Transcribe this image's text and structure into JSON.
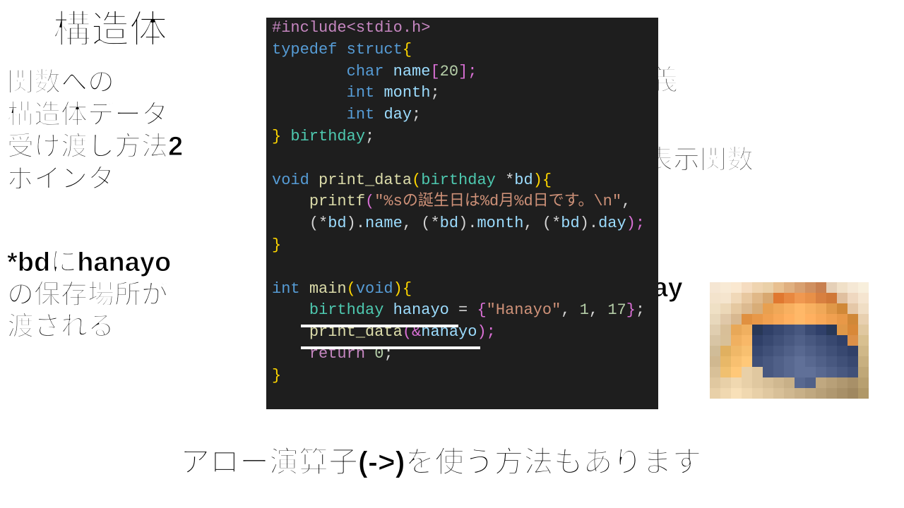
{
  "title": "構造体",
  "subtitle": "関数への\n構造体データ\n受け渡し方法2\nポインタ",
  "note1": "*bdにhanayo\nの保存場所が\n渡される",
  "label_struct_def": "構造体定義",
  "label_print_func": "構造体内容表示関数",
  "label_arrow": "or\nbd->day",
  "bottom_text": "アロー演算子(->)を使う方法もあります",
  "code": {
    "l1a": "#include",
    "l1b": "<stdio.h>",
    "l2a": "typedef",
    "l2b": "struct",
    "l2c": "{",
    "l3a": "char",
    "l3b": "name",
    "l3c": "[",
    "l3d": "20",
    "l3e": "];",
    "l4a": "int",
    "l4b": "month",
    "l4c": ";",
    "l5a": "int",
    "l5b": "day",
    "l5c": ";",
    "l6a": "}",
    "l6b": "birthday",
    "l6c": ";",
    "l8a": "void",
    "l8b": "print_data",
    "l8c": "(",
    "l8d": "birthday",
    "l8e": "*",
    "l8f": "bd",
    "l8g": ")",
    "l8h": "{",
    "l9a": "printf",
    "l9b": "(",
    "l9c": "\"%sの誕生日は%d月%d日です。\\n\"",
    "l9d": ",",
    "l10a": "(*",
    "l10b": "bd",
    "l10c": ").",
    "l10d": "name",
    "l10e": ", (*",
    "l10f": "bd",
    "l10g": ").",
    "l10h": "month",
    "l10i": ", (*",
    "l10j": "bd",
    "l10k": ").",
    "l10l": "day",
    "l10m": ");",
    "l11a": "}",
    "l13a": "int",
    "l13b": "main",
    "l13c": "(",
    "l13d": "void",
    "l13e": ")",
    "l13f": "{",
    "l14a": "birthday",
    "l14b": "hanayo",
    "l14c": " = ",
    "l14d": "{",
    "l14e": "\"Hanayo\"",
    "l14f": ", ",
    "l14g": "1",
    "l14h": ", ",
    "l14i": "17",
    "l14j": "}",
    "l14k": ";",
    "l15a": "print_data",
    "l15b": "(&",
    "l15c": "hanayo",
    "l15d": ");",
    "l16a": "return",
    "l16b": "0",
    "l16c": ";",
    "l17a": "}"
  },
  "mosaic_colors": [
    "#f5e6d3",
    "#f8ead5",
    "#fae8d0",
    "#f5dcc0",
    "#efd4b0",
    "#ead0a8",
    "#e8c090",
    "#e0b080",
    "#d8a070",
    "#d09060",
    "#c88050",
    "#e5d0b8",
    "#f0e0c8",
    "#f5e8d5",
    "#f8efdc",
    "#f3e3cc",
    "#f5e5ce",
    "#f0d8b8",
    "#e8c8a0",
    "#e0b888",
    "#d8a870",
    "#e07830",
    "#e88840",
    "#f09850",
    "#e89048",
    "#d88040",
    "#d07838",
    "#e0c0a0",
    "#efd8c0",
    "#f5e5d0",
    "#efe0c5",
    "#ecd8b8",
    "#e5c8a0",
    "#dcba90",
    "#d8ad78",
    "#e8a050",
    "#f0a858",
    "#f8b060",
    "#ffb868",
    "#f8b060",
    "#f0a858",
    "#e09848",
    "#d08838",
    "#e5c8a8",
    "#f0dec5",
    "#e8d8bc",
    "#e0c8a8",
    "#d8b890",
    "#e09040",
    "#e89848",
    "#f0a050",
    "#f8a858",
    "#ffb060",
    "#ffb868",
    "#ffb060",
    "#f8a858",
    "#f0a050",
    "#e89848",
    "#d08838",
    "#e8d0b0",
    "#e0ceb0",
    "#d8bf98",
    "#e8a858",
    "#f0b060",
    "#283858",
    "#304068",
    "#384870",
    "#405078",
    "#485880",
    "#3a4a72",
    "#30406a",
    "#283858",
    "#e09848",
    "#d88838",
    "#e0c8a0",
    "#d8c5a5",
    "#d8c098",
    "#f0b060",
    "#f8b868",
    "#304068",
    "#384870",
    "#405078",
    "#485880",
    "#506088",
    "#485880",
    "#405078",
    "#384870",
    "#304068",
    "#dc9048",
    "#d8c090",
    "#d0bc98",
    "#e0b060",
    "#f0b868",
    "#f8c070",
    "#384870",
    "#405078",
    "#485880",
    "#506088",
    "#586890",
    "#506088",
    "#485880",
    "#405078",
    "#384870",
    "#304068",
    "#d0b888",
    "#d0b890",
    "#e8b868",
    "#f8c070",
    "#ffc878",
    "#405078",
    "#485880",
    "#506088",
    "#586890",
    "#607098",
    "#586890",
    "#506088",
    "#485880",
    "#405078",
    "#384870",
    "#c8b080",
    "#d8c098",
    "#f0c070",
    "#ffc878",
    "#e8d0a8",
    "#e0c8a0",
    "#485880",
    "#506088",
    "#586890",
    "#607098",
    "#607098",
    "#586890",
    "#506088",
    "#485880",
    "#405078",
    "#c0a878",
    "#e0c8a0",
    "#e8d0a8",
    "#f0d8b0",
    "#e8d0a8",
    "#e0c8a0",
    "#d8c098",
    "#d0b890",
    "#c8b088",
    "#586890",
    "#506088",
    "#c0a880",
    "#b8a078",
    "#b09870",
    "#a89068",
    "#b8a070",
    "#e8d0a8",
    "#f0d8b0",
    "#f8e0b8",
    "#f0d8b0",
    "#e8d0a8",
    "#e0c8a0",
    "#d8c098",
    "#d0b890",
    "#c8b088",
    "#c0a880",
    "#b8a078",
    "#b09870",
    "#a89068",
    "#a08860",
    "#b09868"
  ]
}
